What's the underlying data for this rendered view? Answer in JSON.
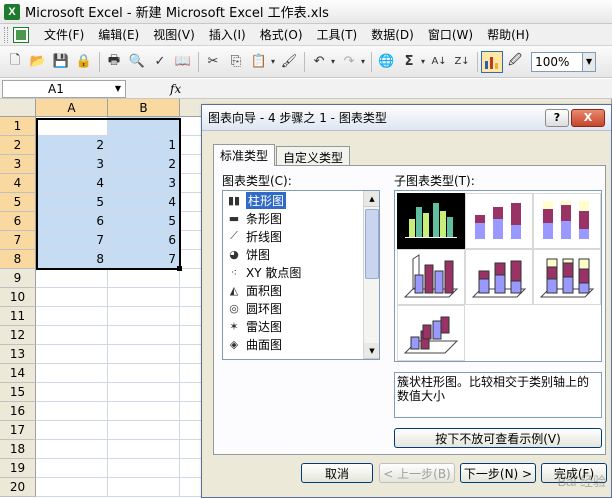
{
  "window": {
    "title": "Microsoft Excel - 新建 Microsoft Excel 工作表.xls",
    "app_icon_letter": "X"
  },
  "menu": [
    "文件(F)",
    "编辑(E)",
    "视图(V)",
    "插入(I)",
    "格式(O)",
    "工具(T)",
    "数据(D)",
    "窗口(W)",
    "帮助(H)"
  ],
  "toolbar": {
    "zoom": "100%",
    "icons": [
      "new-icon",
      "open-icon",
      "save-icon",
      "permission-icon",
      "print-icon",
      "print-preview-icon",
      "spelling-icon",
      "research-icon",
      "cut-icon",
      "copy-icon",
      "paste-icon",
      "format-painter-icon",
      "undo-icon",
      "redo-icon",
      "hyperlink-icon",
      "autosum-icon",
      "sort-ascending-icon",
      "sort-descending-icon",
      "chart-wizard-icon",
      "drawing-icon"
    ]
  },
  "formula_bar": {
    "name_box": "A1",
    "fx_label": "fx"
  },
  "sheet": {
    "columns": [
      "A",
      "B"
    ],
    "rows": [
      "1",
      "2",
      "3",
      "4",
      "5",
      "6",
      "7",
      "8",
      "9",
      "10",
      "11",
      "12",
      "13",
      "14",
      "15",
      "16",
      "17",
      "18",
      "19",
      "20"
    ],
    "data": [
      [
        "",
        ""
      ],
      [
        "2",
        "1"
      ],
      [
        "3",
        "2"
      ],
      [
        "4",
        "3"
      ],
      [
        "5",
        "4"
      ],
      [
        "6",
        "5"
      ],
      [
        "7",
        "6"
      ],
      [
        "8",
        "7"
      ]
    ]
  },
  "dialog": {
    "title": "图表向导 - 4 步骤之 1 - 图表类型",
    "help_label": "?",
    "close_label": "X",
    "tabs": [
      "标准类型",
      "自定义类型"
    ],
    "chart_type_label": "图表类型(C):",
    "subtype_label": "子图表类型(T):",
    "chart_types": [
      {
        "label": "柱形图",
        "icon": "column-chart-icon",
        "glyph": "▮▮"
      },
      {
        "label": "条形图",
        "icon": "bar-chart-icon",
        "glyph": "▬"
      },
      {
        "label": "折线图",
        "icon": "line-chart-icon",
        "glyph": "⟋"
      },
      {
        "label": "饼图",
        "icon": "pie-chart-icon",
        "glyph": "◕"
      },
      {
        "label": "XY 散点图",
        "icon": "scatter-chart-icon",
        "glyph": "⁖"
      },
      {
        "label": "面积图",
        "icon": "area-chart-icon",
        "glyph": "◭"
      },
      {
        "label": "圆环图",
        "icon": "doughnut-chart-icon",
        "glyph": "◎"
      },
      {
        "label": "雷达图",
        "icon": "radar-chart-icon",
        "glyph": "✶"
      },
      {
        "label": "曲面图",
        "icon": "surface-chart-icon",
        "glyph": "◈"
      }
    ],
    "description": "簇状柱形图。比较相交于类别轴上的数值大小",
    "preview_button": "按下不放可查看示例(V)",
    "buttons": {
      "cancel": "取消",
      "back": "< 上一步(B)",
      "next": "下一步(N) >",
      "finish": "完成(F)"
    }
  },
  "watermark": "Bai 经验"
}
